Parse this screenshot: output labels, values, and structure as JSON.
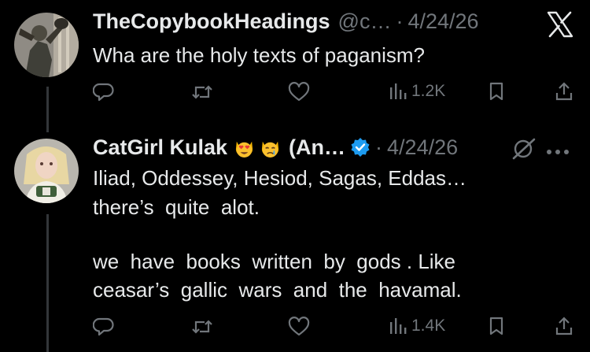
{
  "post": {
    "display_name": "TheCopybookHeadings",
    "handle": "@c…",
    "separator": "·",
    "date": "4/24/26",
    "text": "Wha are the holy texts of paganism?",
    "views": "1.2K"
  },
  "reply": {
    "display_name": "CatGirl Kulak",
    "name_suffix": "(An…",
    "separator": "·",
    "date": "4/24/26",
    "text_lines": [
      "Iliad, Oddessey, Hesiod, Sagas, Eddas…",
      "there’s  quite  alot.",
      "",
      "we  have  books  written  by  gods . Like",
      "ceasar’s  gallic  wars  and  the  havamal."
    ],
    "views": "1.4K",
    "emojis": [
      "heart-eyes-cat-emoji",
      "crying-cat-emoji"
    ]
  },
  "icons": {
    "x_logo": "x-logo-icon",
    "reply": "reply-icon",
    "repost": "repost-icon",
    "like": "like-icon",
    "views": "views-icon",
    "bookmark": "bookmark-icon",
    "share": "share-icon",
    "grok": "grok-icon",
    "more": "more-icon"
  },
  "colors": {
    "background": "#000000",
    "primary_text": "#e7e9ea",
    "secondary_text": "#71767b",
    "verified_blue": "#1d9bf0"
  }
}
